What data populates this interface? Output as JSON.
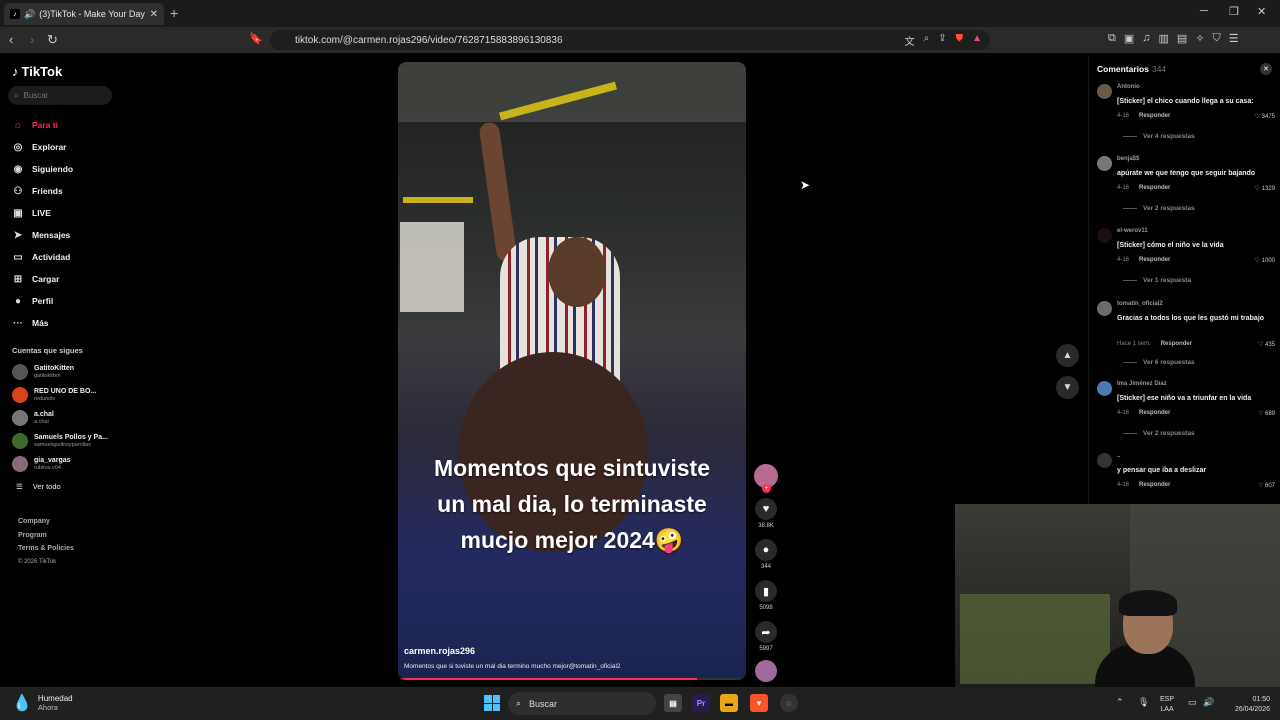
{
  "browser": {
    "tab_title": "(3)TikTok - Make Your Day",
    "url": "tiktok.com/@carmen.rojas296/video/7628715883896130836"
  },
  "sidebar": {
    "logo": "TikTok",
    "search_placeholder": "Buscar",
    "menu": [
      {
        "label": "Para ti",
        "icon": "home-icon"
      },
      {
        "label": "Explorar",
        "icon": "compass-icon"
      },
      {
        "label": "Siguiendo",
        "icon": "following-icon"
      },
      {
        "label": "Friends",
        "icon": "friends-icon"
      },
      {
        "label": "LIVE",
        "icon": "live-icon"
      },
      {
        "label": "Mensajes",
        "icon": "messages-icon"
      },
      {
        "label": "Actividad",
        "icon": "activity-icon"
      },
      {
        "label": "Cargar",
        "icon": "upload-icon"
      },
      {
        "label": "Perfil",
        "icon": "profile-icon"
      },
      {
        "label": "Más",
        "icon": "more-icon"
      }
    ],
    "following_title": "Cuentas que sigues",
    "following": [
      {
        "name": "GatitoKitten",
        "handle": "gatitokitten"
      },
      {
        "name": "RED UNO DE BO...",
        "handle": "redunotv"
      },
      {
        "name": "a.chal",
        "handle": "a.chal"
      },
      {
        "name": "Samuels Pollos y Pa...",
        "handle": "samuelspollosyparrillas"
      },
      {
        "name": "gia_vargas",
        "handle": "rubitos.v04"
      }
    ],
    "see_all": "Ver todo",
    "footer": [
      "Company",
      "Program",
      "Terms & Policies"
    ],
    "copyright": "© 2026 TikTok"
  },
  "video": {
    "caption_lines": [
      "Momentos que sintuviste",
      "un mal dia, lo terminaste",
      "mucjo mejor 2024🤪"
    ],
    "username": "carmen.rojas296",
    "description": "Momentos que si tuviste un mal dia termino mucho mejor@tomatin_oficial2",
    "progress": 0.86
  },
  "actions": {
    "likes": "38.8K",
    "comments": "344",
    "saves": "5098",
    "shares": "5997"
  },
  "comments_panel": {
    "title": "Comentarios",
    "count": "344",
    "reply_label": "Responder",
    "items": [
      {
        "user": "Antonio",
        "text": "[Sticker] el chico cuando llega a su casa:",
        "date": "4-16",
        "likes": "3475",
        "more": "Ver 4 respuestas"
      },
      {
        "user": "benja$$",
        "text": "apúrate we que tengo que seguir bajando",
        "date": "4-16",
        "likes": "1329",
        "more": "Ver 2 respuestas"
      },
      {
        "user": "el-werov11",
        "text": "[Sticker] cómo el niño ve la vida",
        "date": "4-16",
        "likes": "1000",
        "more": "Ver 1 respuesta"
      },
      {
        "user": "tomatin_oficial2",
        "text": "Gracias a todos los que les gustó mi trabajo",
        "date": "Hace 1 sem.",
        "likes": "435",
        "more": "Ver 6 respuestas"
      },
      {
        "user": "lma Jiménez Díaz",
        "text": "[Sticker] ese niño va a triunfar en la vida",
        "date": "4-16",
        "likes": "689",
        "more": "Ver 2 respuestas"
      },
      {
        "user": "..",
        "text": "y pensar que iba a deslizar",
        "date": "4-16",
        "likes": "607",
        "more": ""
      }
    ]
  },
  "taskbar": {
    "weather_title": "Humedad",
    "weather_sub": "Ahora",
    "search_placeholder": "Buscar",
    "lang1": "ESP",
    "lang2": "LAA",
    "time": "01:50",
    "date": "26/04/2026"
  }
}
